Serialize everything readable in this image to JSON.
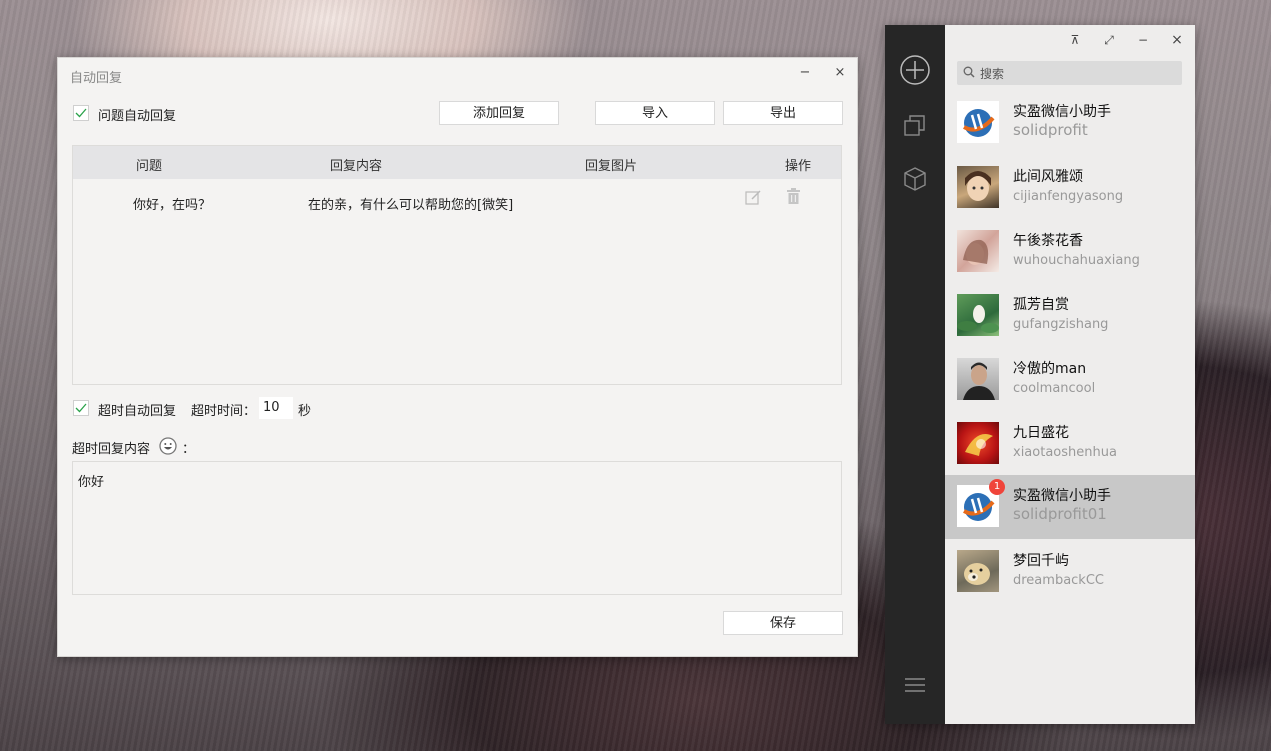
{
  "dialog": {
    "title": "自动回复",
    "question_auto_reply_label": "问题自动回复",
    "add_reply_button": "添加回复",
    "import_button": "导入",
    "export_button": "导出",
    "table": {
      "headers": [
        "问题",
        "回复内容",
        "回复图片",
        "操作"
      ],
      "rows": [
        {
          "question": "你好，在吗？",
          "reply": "在的亲，有什么可以帮助您的[微笑]",
          "image": ""
        }
      ]
    },
    "timeout_auto_reply_label": "超时自动回复",
    "timeout_label": "超时时间：",
    "timeout_value": "10",
    "timeout_unit": "秒",
    "timeout_content_label": "超时回复内容",
    "colon": "：",
    "timeout_content": "你好",
    "save_button": "保存",
    "minimize": "−",
    "close": "×"
  },
  "chat": {
    "search_placeholder": "搜索",
    "window_controls": {
      "pin": "⊼",
      "restore": "⤢",
      "minimize": "−",
      "close": "×"
    },
    "contacts": [
      {
        "name": "实盈微信小助手",
        "id": "solidprofit",
        "avatar": "solidprofit-logo"
      },
      {
        "name": "此间风雅颂",
        "id": "cijianfengyasong",
        "avatar": "anime-girl"
      },
      {
        "name": "午後茶花香",
        "id": "wuhouchahuaxiang",
        "avatar": "woman-portrait"
      },
      {
        "name": "孤芳自赏",
        "id": "gufangzishang",
        "avatar": "lotus-flower"
      },
      {
        "name": "冷傲的man",
        "id": "coolmancool",
        "avatar": "man-portrait"
      },
      {
        "name": "九日盛花",
        "id": "xiaotaoshenhua",
        "avatar": "red-abstract"
      },
      {
        "name": "实盈微信小助手",
        "id": "solidprofit01",
        "avatar": "solidprofit-logo",
        "badge": "1",
        "selected": true
      },
      {
        "name": "梦回千屿",
        "id": "dreambackCC",
        "avatar": "dog-photo"
      }
    ],
    "colors": {
      "sidebar": "#262626",
      "list_bg": "#eeedec",
      "selected": "#c8c8c8",
      "badge": "#f0443a"
    }
  }
}
